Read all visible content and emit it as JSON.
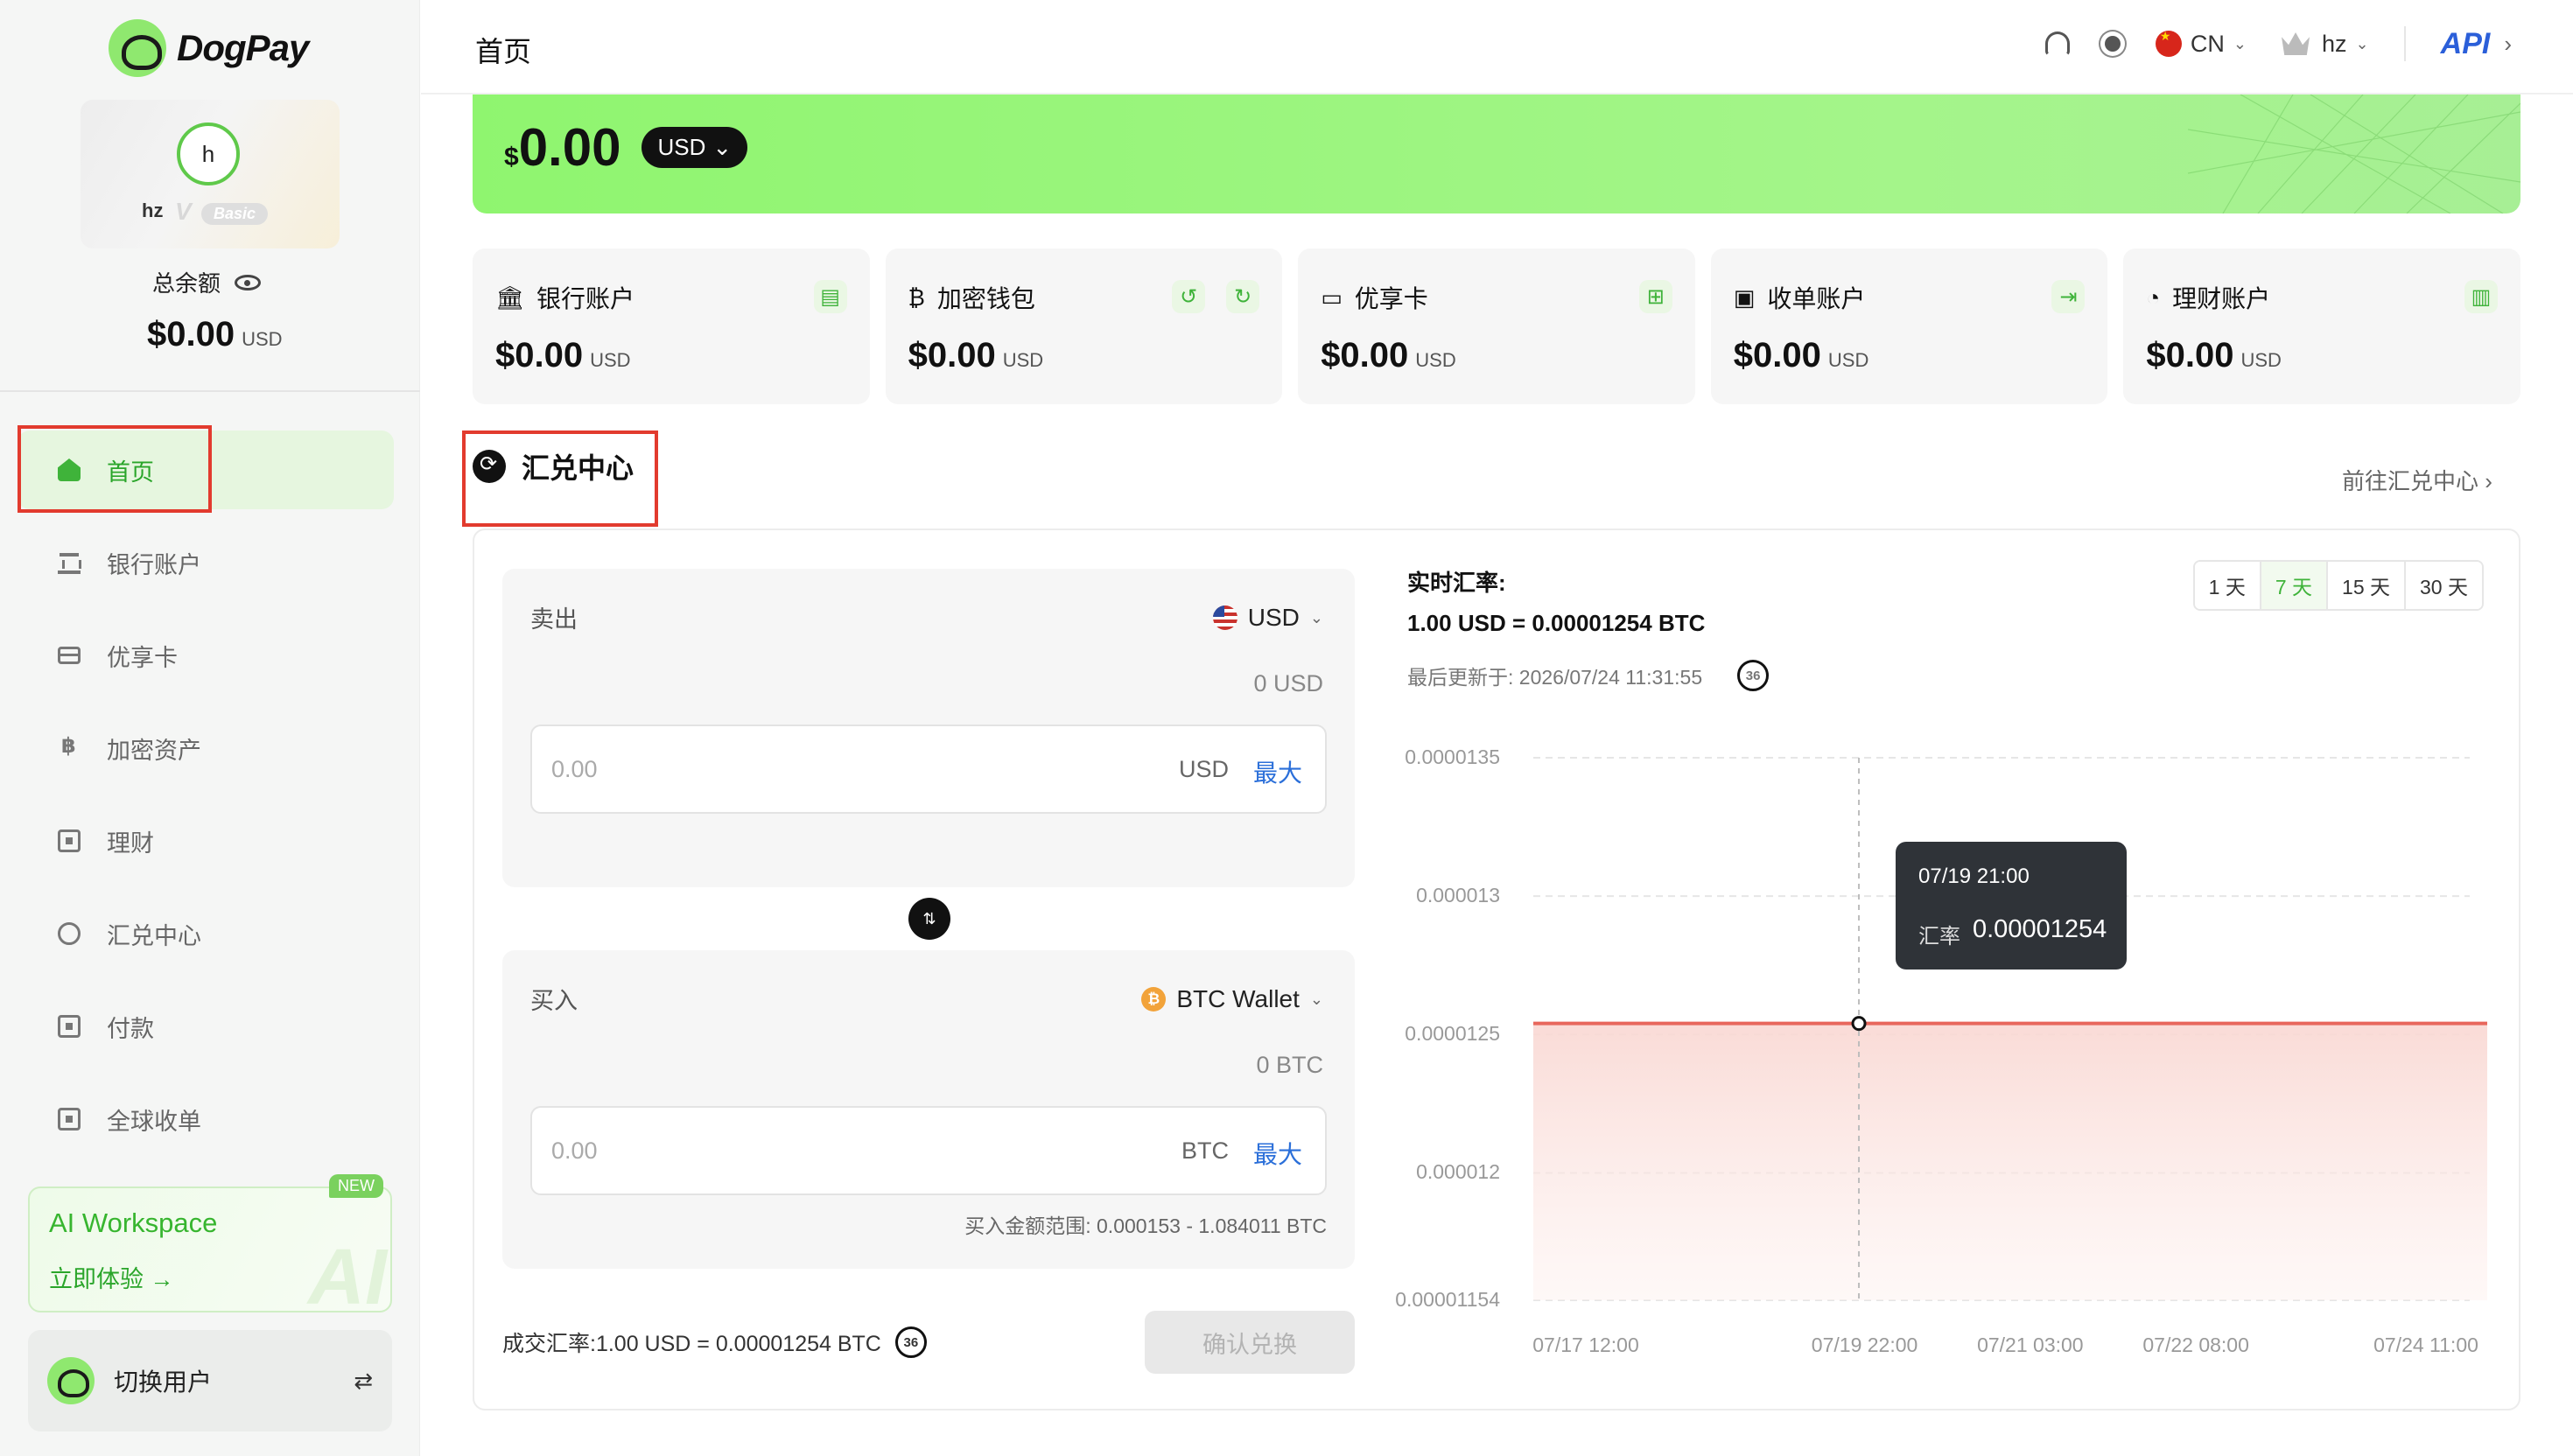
{
  "app": {
    "brand": "DogPay"
  },
  "profile": {
    "avatar_letter": "h",
    "name": "hz",
    "level": "V",
    "badge": "Basic"
  },
  "balance": {
    "label": "总余额",
    "amount": "$0.00",
    "currency": "USD"
  },
  "sidebar": {
    "items": [
      {
        "label": "首页",
        "icon": "home-icon",
        "active": true
      },
      {
        "label": "银行账户",
        "icon": "bank-icon",
        "active": false
      },
      {
        "label": "优享卡",
        "icon": "card-icon",
        "active": false
      },
      {
        "label": "加密资产",
        "icon": "bitcoin-icon",
        "active": false
      },
      {
        "label": "理财",
        "icon": "finance-icon",
        "active": false
      },
      {
        "label": "汇兑中心",
        "icon": "exchange-icon",
        "active": false
      },
      {
        "label": "付款",
        "icon": "payment-icon",
        "active": false
      },
      {
        "label": "全球收单",
        "icon": "acquiring-icon",
        "active": false
      }
    ],
    "ai_card": {
      "title": "AI Workspace",
      "cta": "立即体验 →",
      "watermark": "AI",
      "badge": "NEW"
    },
    "switch_user": {
      "label": "切换用户",
      "swap": "⇄"
    }
  },
  "header": {
    "title": "首页",
    "language": "CN",
    "user": "hz",
    "api": "API",
    "chevron": "⌄",
    "right_chevron": "›"
  },
  "hero": {
    "amount_symbol": "$",
    "amount": "0.00",
    "currency": "USD"
  },
  "accounts": [
    {
      "title": "银行账户",
      "icon": "bank-icon",
      "amount": "$0.00",
      "currency": "USD"
    },
    {
      "title": "加密钱包",
      "icon": "bitcoin-icon",
      "amount": "$0.00",
      "currency": "USD"
    },
    {
      "title": "优享卡",
      "icon": "card-icon",
      "amount": "$0.00",
      "currency": "USD"
    },
    {
      "title": "收单账户",
      "icon": "wallet-icon",
      "amount": "$0.00",
      "currency": "USD"
    },
    {
      "title": "理财账户",
      "icon": "finance-icon",
      "amount": "$0.00",
      "currency": "USD"
    }
  ],
  "exchange": {
    "title": "汇兑中心",
    "goto": "前往汇兑中心 ›",
    "sell": {
      "label": "卖出",
      "currency": "USD",
      "available": "0 USD",
      "placeholder": "0.00",
      "unit": "USD",
      "max": "最大"
    },
    "buy": {
      "label": "买入",
      "currency": "BTC Wallet",
      "available": "0 BTC",
      "placeholder": "0.00",
      "unit": "BTC",
      "max": "最大",
      "range": "买入金额范围:  0.000153 - 1.084011 BTC"
    },
    "deal_rate": "成交汇率:1.00 USD = 0.00001254 BTC",
    "timer": "36",
    "confirm": "确认兑换",
    "rate_label": "实时汇率:",
    "rate_value": "1.00 USD = 0.00001254 BTC",
    "last_update": "最后更新于: 2026/07/24 11:31:55",
    "periods": [
      "1 天",
      "7 天",
      "15 天",
      "30 天"
    ],
    "active_period": "7 天",
    "tooltip": {
      "time": "07/19 21:00",
      "label": "汇率",
      "value": "0.00001254"
    }
  },
  "colors": {
    "brand_green": "#3fb33a",
    "hero_green": "#8ff56f",
    "line_red": "#e8675c",
    "link_blue": "#2b6fd9",
    "highlight_red": "#e23b2e"
  },
  "chart_data": {
    "type": "line",
    "title": "",
    "xlabel": "",
    "ylabel": "",
    "x_ticks": [
      "07/17 12:00",
      "07/19 22:00",
      "07/21 03:00",
      "07/22 08:00",
      "07/24 11:00"
    ],
    "y_ticks": [
      "0.0000135",
      "0.000013",
      "0.0000125",
      "0.000012",
      "0.00001154"
    ],
    "ylim": [
      1.154e-05,
      1.35e-05
    ],
    "series": [
      {
        "x": [
          "07/17 12:00",
          "07/24 11:00"
        ],
        "values": [
          1.254e-05,
          1.254e-05
        ]
      }
    ],
    "hover": {
      "x": "07/19 21:00",
      "value": 1.254e-05
    },
    "grid": true,
    "area_fill": true
  }
}
